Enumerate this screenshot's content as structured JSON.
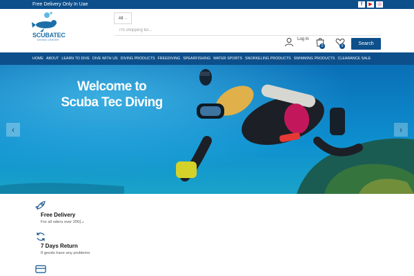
{
  "topbar": {
    "promo": "Free Delivery Only In Uae",
    "social": [
      "facebook-icon",
      "youtube-icon",
      "instagram-icon"
    ],
    "social_glyphs": {
      "facebook": "f",
      "youtube": "▶",
      "instagram": "◎"
    }
  },
  "logo": {
    "word": "SCUBATEC",
    "tagline": "DIVING CENTER"
  },
  "search": {
    "category": "All",
    "placeholder": "I'm shopping for...",
    "button": "Search"
  },
  "account": {
    "login_label": "Log In",
    "cart_count": "0",
    "wishlist_count": "0"
  },
  "nav": {
    "items": [
      "Home",
      "About",
      "Learn To Dive",
      "Dive With Us",
      "Diving Products",
      "Freediving",
      "Spearfishing",
      "Water Sports",
      "Snorkeling Products",
      "Swimming Products",
      "Clearance Sale"
    ]
  },
  "hero": {
    "title_line1": "Welcome to",
    "title_line2": "Scuba Tec Diving",
    "prev_glyph": "‹",
    "next_glyph": "›"
  },
  "features": [
    {
      "icon": "rocket-icon",
      "title": "Free Delivery",
      "subtitle": "For all oders over 200د.إ"
    },
    {
      "icon": "return-icon",
      "title": "7 Days Return",
      "subtitle": "If goods have any problems"
    },
    {
      "icon": "credit-card-icon",
      "title": "",
      "subtitle": ""
    }
  ],
  "colors": {
    "brand": "#0d4f8b",
    "hero_water": "#0c84c4"
  }
}
